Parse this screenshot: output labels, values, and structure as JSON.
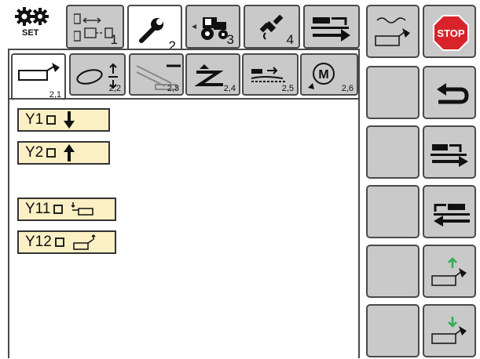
{
  "header": {
    "set_label": "SET",
    "tabs": [
      {
        "num": "1",
        "icon": "hitch-mode-icon"
      },
      {
        "num": "2",
        "icon": "wrench-icon"
      },
      {
        "num": "3",
        "icon": "tractor-icon"
      },
      {
        "num": "4",
        "icon": "satellite-icon"
      },
      {
        "num": "",
        "icon": "transport-forward-icon"
      }
    ],
    "active_tab": "2"
  },
  "subtabs": [
    {
      "num": "2,1",
      "icon": "implement-raise-icon"
    },
    {
      "num": "2,2",
      "icon": "belt-adjust-icon"
    },
    {
      "num": "2,3",
      "icon": "slope-sensor-icon"
    },
    {
      "num": "2,4",
      "icon": "zigzag-up-icon"
    },
    {
      "num": "2,5",
      "icon": "conveyor-icon"
    },
    {
      "num": "2,6",
      "icon": "manual-mode-icon",
      "badge": "M"
    }
  ],
  "functions": [
    {
      "label": "Y1",
      "icon": "arrow-down-icon"
    },
    {
      "label": "Y2",
      "icon": "arrow-up-icon"
    },
    {
      "label": "Y11",
      "icon": "fold-in-icon"
    },
    {
      "label": "Y12",
      "icon": "fold-out-icon"
    }
  ],
  "side": {
    "stop_label": "STOP"
  },
  "colors": {
    "button_gray": "#c9c9c9",
    "function_yellow": "#fbf0c4",
    "stop_red": "#d8232a",
    "arrow_green": "#2bb24c"
  }
}
